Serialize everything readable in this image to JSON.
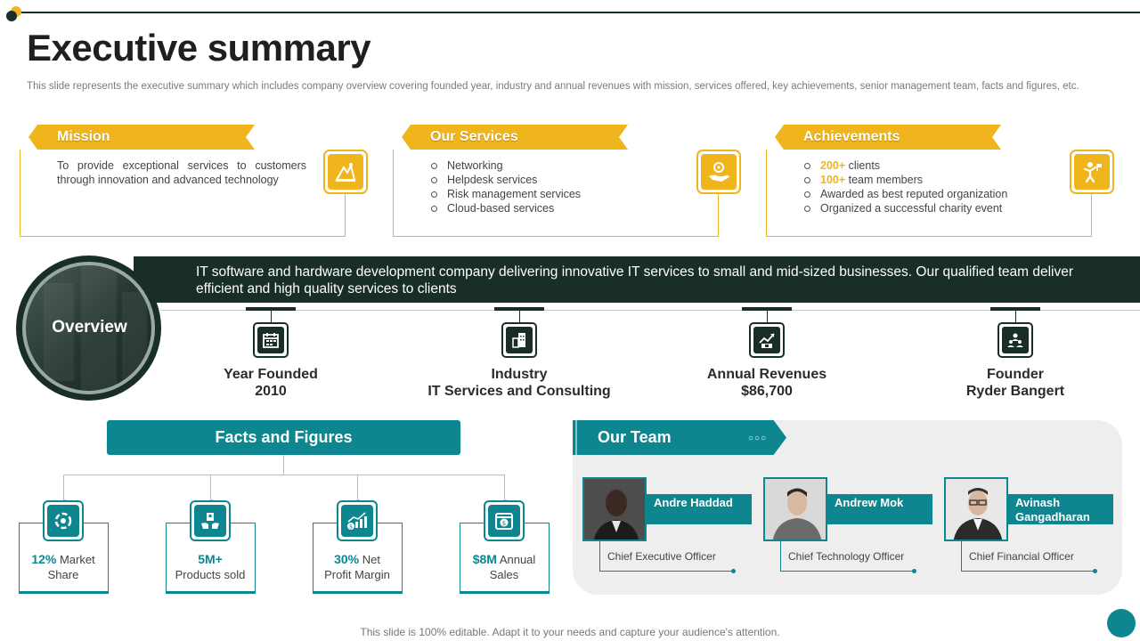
{
  "title": "Executive summary",
  "description": "This slide represents the executive summary which includes company overview covering founded year, industry and annual revenues with mission, services offered, key achievements, senior management team, facts and figures, etc.",
  "mission": {
    "heading": "Mission",
    "text": "To provide exceptional services to customers through innovation and advanced technology",
    "icon": "mission-icon"
  },
  "services": {
    "heading": "Our Services",
    "items": [
      "Networking",
      "Helpdesk services",
      "Risk management services",
      "Cloud-based services"
    ],
    "icon": "services-hand-icon"
  },
  "achievements": {
    "heading": "Achievements",
    "items": [
      {
        "highlight": "200+",
        "text": " clients"
      },
      {
        "highlight": "100+",
        "text": " team members"
      },
      {
        "highlight": "",
        "text": "Awarded as best reputed organization"
      },
      {
        "highlight": "",
        "text": "Organized a successful charity event"
      }
    ],
    "icon": "achievement-icon"
  },
  "overview": {
    "label": "Overview",
    "text": "IT software and hardware development company delivering innovative IT services to small and mid-sized businesses. Our qualified team deliver efficient and high quality services to clients",
    "facts": [
      {
        "label": "Year Founded",
        "value": "2010",
        "icon": "calendar-icon"
      },
      {
        "label": "Industry",
        "value": "IT Services and Consulting",
        "icon": "building-icon"
      },
      {
        "label": "Annual Revenues",
        "value": "$86,700",
        "icon": "revenue-icon"
      },
      {
        "label": "Founder",
        "value": "Ryder Bangert",
        "icon": "founder-icon"
      }
    ]
  },
  "facts_figures": {
    "heading": "Facts and Figures",
    "items": [
      {
        "value": "12%",
        "label1": " Market",
        "label2": "Share",
        "icon": "pie-chart-icon"
      },
      {
        "value": "5M+",
        "label1": "",
        "label2": "Products sold",
        "icon": "product-hand-icon"
      },
      {
        "value": "30%",
        "label1": " Net",
        "label2": "Profit Margin",
        "icon": "profit-chart-icon"
      },
      {
        "value": "$8M",
        "label1": " Annual",
        "label2": "Sales",
        "icon": "dollar-calendar-icon"
      }
    ]
  },
  "team": {
    "heading": "Our Team",
    "members": [
      {
        "name": "Andre Haddad",
        "role": "Chief Executive Officer"
      },
      {
        "name": "Andrew Mok",
        "role": "Chief Technology Officer"
      },
      {
        "name": "Avinash Gangadharan",
        "role": "Chief Financial Officer"
      }
    ]
  },
  "footer": "This slide is 100% editable. Adapt it to your needs and capture your audience's attention.",
  "colors": {
    "accent": "#f0b41c",
    "dark": "#1a2e28",
    "teal": "#0d8690"
  }
}
